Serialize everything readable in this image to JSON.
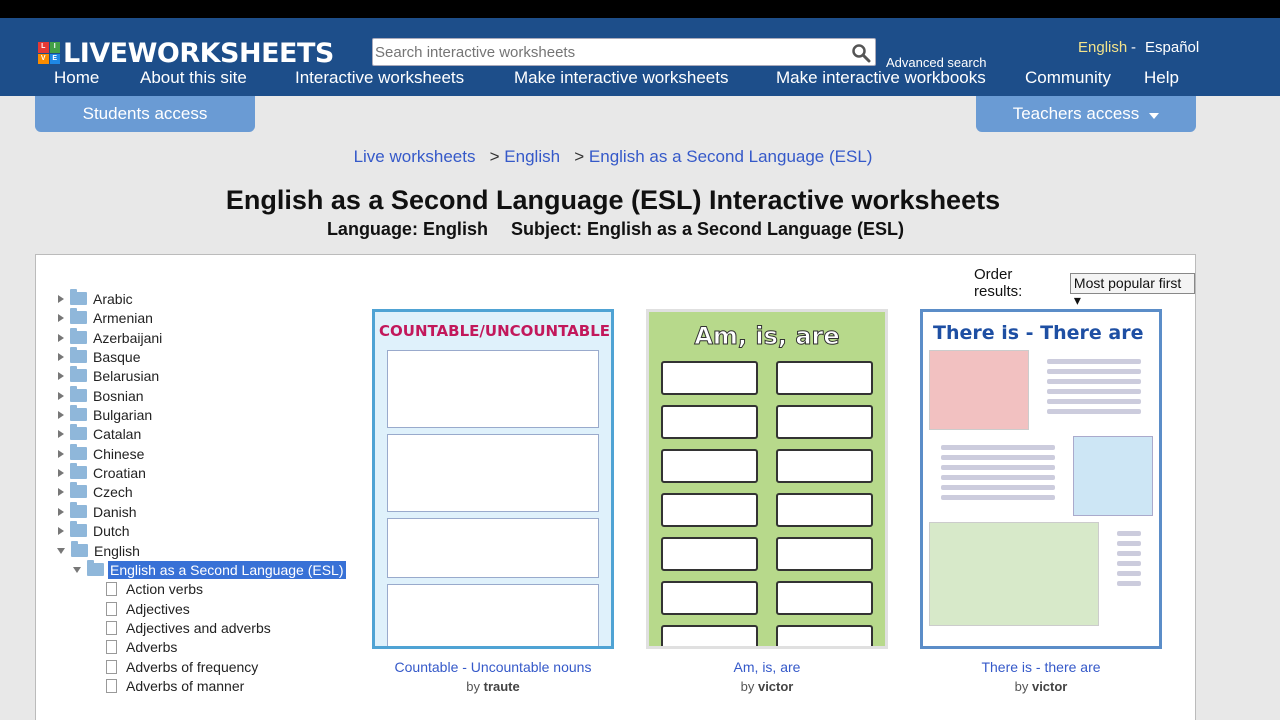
{
  "header": {
    "logo_letters": [
      "L",
      "I",
      "V",
      "E"
    ],
    "logo_text": "LIVEWORKSHEETS",
    "search_placeholder": "Search interactive worksheets",
    "advanced_search": "Advanced search",
    "lang_english": "English",
    "lang_separator": "-",
    "lang_spanish": "Español",
    "colors": {
      "header_bg": "#1d4e8a",
      "access_btn": "#6a9bd4",
      "active_lang": "#f3e38a",
      "link": "#3559c9"
    }
  },
  "nav": {
    "home": "Home",
    "about": "About this site",
    "interactive": "Interactive worksheets",
    "make_worksheets": "Make interactive worksheets",
    "make_workbooks": "Make interactive workbooks",
    "community": "Community",
    "help": "Help"
  },
  "access": {
    "students": "Students access",
    "teachers": "Teachers access"
  },
  "breadcrumb": {
    "live": "Live worksheets",
    "sep": ">",
    "english": "English",
    "esl": "English as a Second Language (ESL)"
  },
  "page": {
    "title": "English as a Second Language (ESL) Interactive worksheets",
    "language": "Language: English",
    "subject": "Subject: English as a Second Language (ESL)"
  },
  "order": {
    "label": "Order results:",
    "value": "Most popular first ▾"
  },
  "tree": {
    "languages": [
      "Arabic",
      "Armenian",
      "Azerbaijani",
      "Basque",
      "Belarusian",
      "Bosnian",
      "Bulgarian",
      "Catalan",
      "Chinese",
      "Croatian",
      "Czech",
      "Danish",
      "Dutch",
      "English"
    ],
    "selected": "English as a Second Language (ESL)",
    "topics": [
      "Action verbs",
      "Adjectives",
      "Adjectives and adverbs",
      "Adverbs",
      "Adverbs of frequency",
      "Adverbs of manner"
    ]
  },
  "worksheets": [
    {
      "thumb_title": "COUNTABLE/UNCOUNTABLE",
      "title": "Countable - Uncountable nouns",
      "by": "by",
      "author": "traute"
    },
    {
      "thumb_title": "Am, is, are",
      "title": "Am, is, are",
      "by": "by",
      "author": "victor"
    },
    {
      "thumb_title": "There is - There are",
      "title": "There is - there are",
      "by": "by",
      "author": "victor"
    }
  ]
}
